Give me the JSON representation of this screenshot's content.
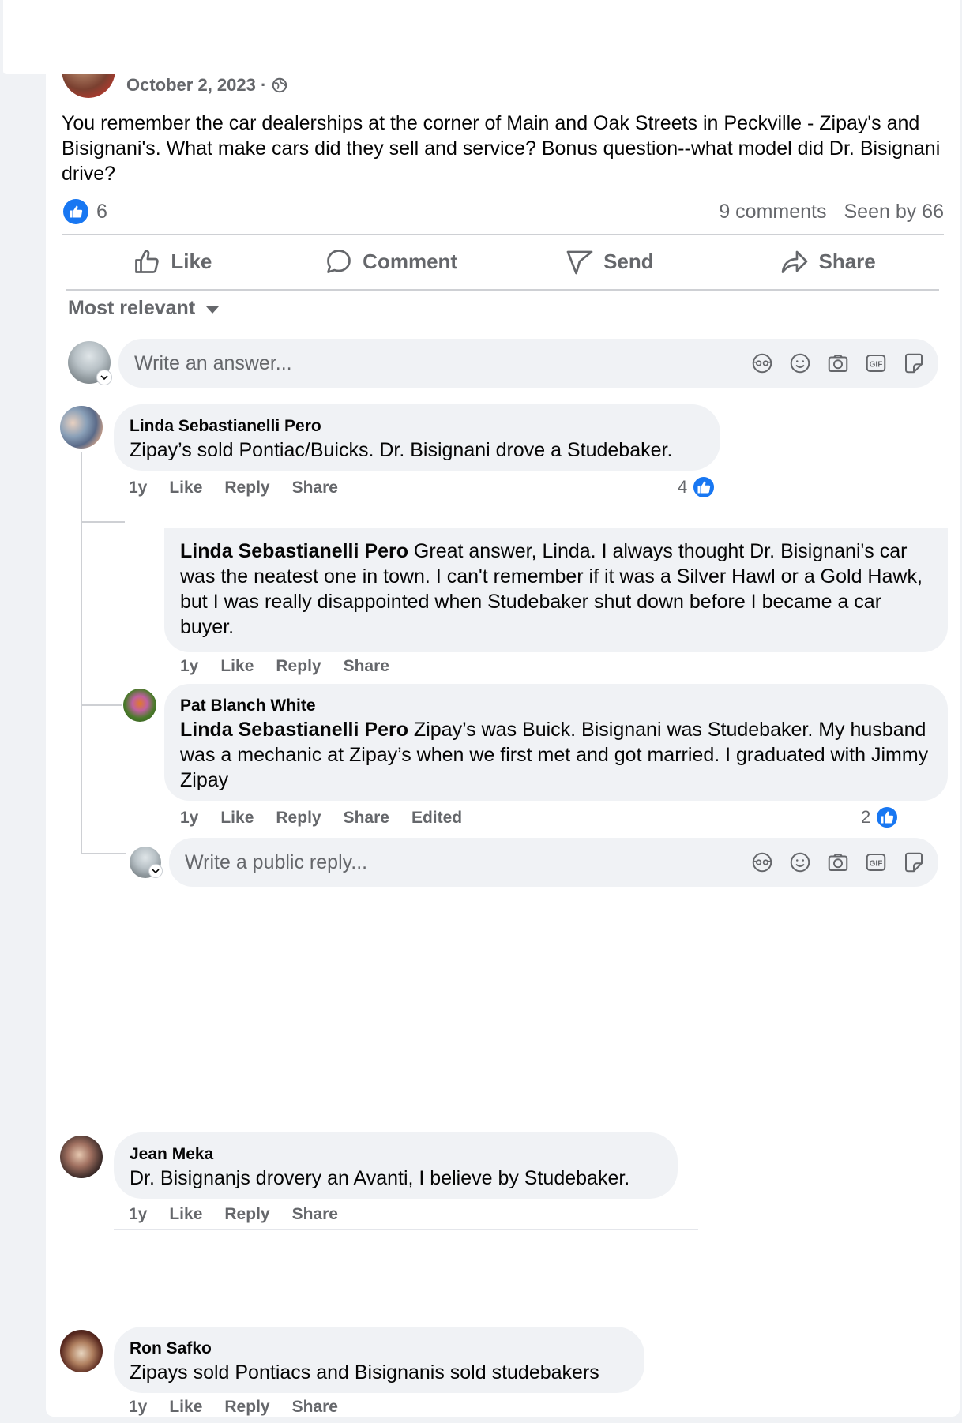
{
  "post": {
    "date": "October 2, 2023 ·",
    "text": "You remember the car dealerships at the corner of Main and Oak Streets in Peckville  - Zipay's and Bisignani's. What make cars did they sell and service? Bonus question--what model did Dr. Bisignani drive?",
    "like_count": "6",
    "comments_count": "9 comments",
    "seen_by": "Seen by 66"
  },
  "actions": {
    "like": "Like",
    "comment": "Comment",
    "send": "Send",
    "share": "Share"
  },
  "sort": {
    "label": "Most relevant"
  },
  "composer": {
    "placeholder": "Write an answer..."
  },
  "reply_composer": {
    "placeholder": "Write a public reply..."
  },
  "comments": [
    {
      "name": "Linda Sebastianelli Pero",
      "text": "Zipay’s sold Pontiac/Buicks. Dr. Bisignani drove a Studebaker.",
      "time": "1y",
      "like": "Like",
      "reply": "Reply",
      "share": "Share",
      "reactions": "4",
      "replies": [
        {
          "mention": "Linda Sebastianelli Pero",
          "text": " Great answer, Linda. I always thought Dr. Bisignani's car was the neatest one in town. I can't remember if it was a Silver Hawl or a Gold Hawk, but I was really disappointed when Studebaker shut down before I became a car buyer.",
          "time": "1y",
          "like": "Like",
          "reply": "Reply",
          "share": "Share"
        },
        {
          "name": "Pat Blanch White",
          "mention": "Linda Sebastianelli Pero",
          "text": " Zipay’s was Buick. Bisignani was Studebaker. My husband was a mechanic at Zipay’s when we first met and got married. I graduated with Jimmy Zipay",
          "time": "1y",
          "like": "Like",
          "reply": "Reply",
          "share": "Share",
          "edited": "Edited",
          "reactions": "2"
        }
      ]
    },
    {
      "name": "Jean Meka",
      "text": "Dr. Bisignanjs drovery an Avanti, I believe by Studebaker.",
      "time": "1y",
      "like": "Like",
      "reply": "Reply",
      "share": "Share"
    },
    {
      "name": "Ron Safko",
      "text": "Zipays sold Pontiacs and Bisignanis sold studebakers",
      "time": "1y",
      "like": "Like",
      "reply": "Reply",
      "share": "Share"
    }
  ],
  "colors": {
    "accent": "#1877f2",
    "bubble": "#f0f2f5",
    "secondary_text": "#65676b"
  }
}
